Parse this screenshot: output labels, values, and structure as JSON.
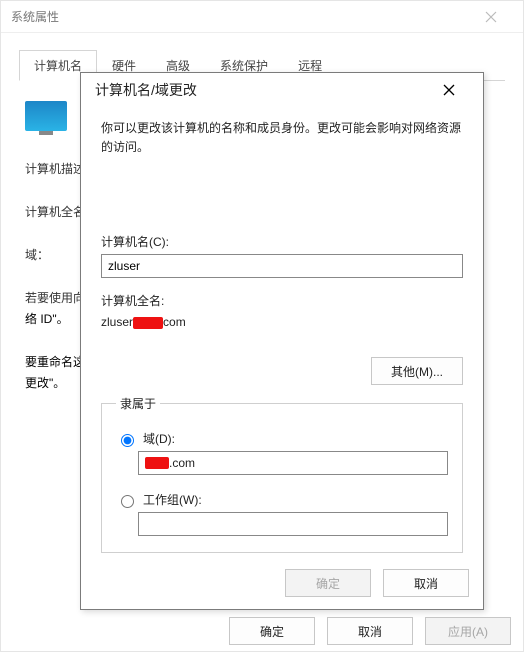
{
  "parent": {
    "title": "系统属性",
    "tabs": [
      "计算机名",
      "硬件",
      "高级",
      "系统保护",
      "远程"
    ],
    "active_tab_index": 0,
    "lines": {
      "desc_truncated": "计算机描述",
      "fullname_truncated": "计算机全名",
      "domain_label": "域：",
      "netid_line1": "若要使用向",
      "netid_line2": "络 ID\"。",
      "rename_line1": "要重命名这",
      "rename_line2": "更改\"。"
    },
    "buttons": {
      "ok": "确定",
      "cancel": "取消",
      "apply": "应用(A)"
    }
  },
  "dialog": {
    "title": "计算机名/域更改",
    "description": "你可以更改该计算机的名称和成员身份。更改可能会影响对网络资源的访问。",
    "computer_name_label": "计算机名(C):",
    "computer_name_value": "zluser",
    "full_name_label": "计算机全名:",
    "full_name_prefix": "zluser",
    "full_name_suffix": "com",
    "other_button": "其他(M)...",
    "member_of_legend": "隶属于",
    "domain_radio_label": "域(D):",
    "domain_value_suffix": ".com",
    "workgroup_radio_label": "工作组(W):",
    "workgroup_value": "",
    "buttons": {
      "ok": "确定",
      "cancel": "取消"
    }
  }
}
